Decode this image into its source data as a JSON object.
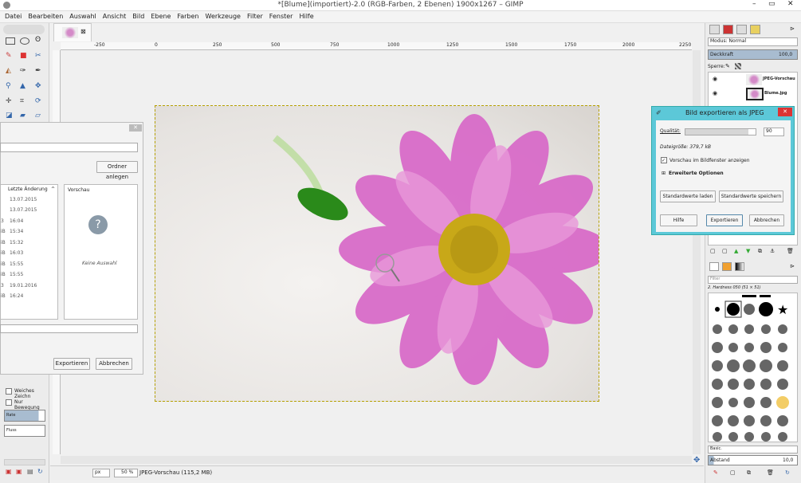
{
  "window": {
    "title": "*[Blume](importiert)-2.0 (RGB-Farben, 2 Ebenen) 1900x1267 – GIMP",
    "min": "–",
    "max": "▭",
    "close": "✕"
  },
  "menu": [
    "Datei",
    "Bearbeiten",
    "Auswahl",
    "Ansicht",
    "Bild",
    "Ebene",
    "Farben",
    "Werkzeuge",
    "Filter",
    "Fenster",
    "Hilfe"
  ],
  "ruler": {
    "ticks": [
      "-250",
      "0",
      "250",
      "500",
      "750",
      "1000",
      "1250",
      "1500",
      "1750",
      "2000",
      "2250"
    ]
  },
  "layers_panel": {
    "mode_label": "Modus: Normal",
    "opacity_label": "Deckkraft",
    "opacity_value": "100,0",
    "lock_label": "Sperre:",
    "layers": [
      {
        "name": "JPEG-Vorschau"
      },
      {
        "name": "Blume.jpg"
      }
    ]
  },
  "brushes_panel": {
    "filter_placeholder": "Filter",
    "brush_name": "2. Hardness 050 (51 × 51)",
    "preset": "Basic.",
    "spacing_label": "Abstand",
    "spacing_value": "10,0"
  },
  "export_dialog": {
    "title": "Bild exportieren als JPEG",
    "quality_label": "Qualität:",
    "quality_value": "90",
    "quality_level": 0.9,
    "filesize": "Dateigröße: 379,7 kB",
    "preview_label": "Vorschau im Bildfenster anzeigen",
    "advanced_label": "Erweiterte Optionen",
    "load_defaults": "Standardwerte laden",
    "save_defaults": "Standardwerte speichern",
    "help": "Hilfe",
    "export": "Exportieren",
    "cancel": "Abbrechen"
  },
  "file_dialog": {
    "create_folder": "Ordner anlegen",
    "col_modified": "Letzte Änderung",
    "preview_header": "Vorschau",
    "no_selection": "Keine Auswahl",
    "rows": [
      {
        "size": "",
        "date": "13.07.2015"
      },
      {
        "size": "",
        "date": "13.07.2015"
      },
      {
        "size": "3",
        "date": "16:04"
      },
      {
        "size": "iB",
        "date": "15:34"
      },
      {
        "size": "iB",
        "date": "15:32"
      },
      {
        "size": "iB",
        "date": "16:03"
      },
      {
        "size": "iB",
        "date": "15:55"
      },
      {
        "size": "iB",
        "date": "15:55"
      },
      {
        "size": "3",
        "date": "19.01.2016"
      },
      {
        "size": "iB",
        "date": "16:24"
      }
    ],
    "export": "Exportieren",
    "cancel": "Abbrechen"
  },
  "tool_options": {
    "smooth_label": "Weiches Zeichn",
    "motion_label": "Nur Bewegung",
    "rate_label": "Rate",
    "flow_label": "Fluss"
  },
  "statusbar": {
    "unit": "px",
    "zoom": "50 %",
    "info": "JPEG-Vorschau (115,2 MB)"
  }
}
